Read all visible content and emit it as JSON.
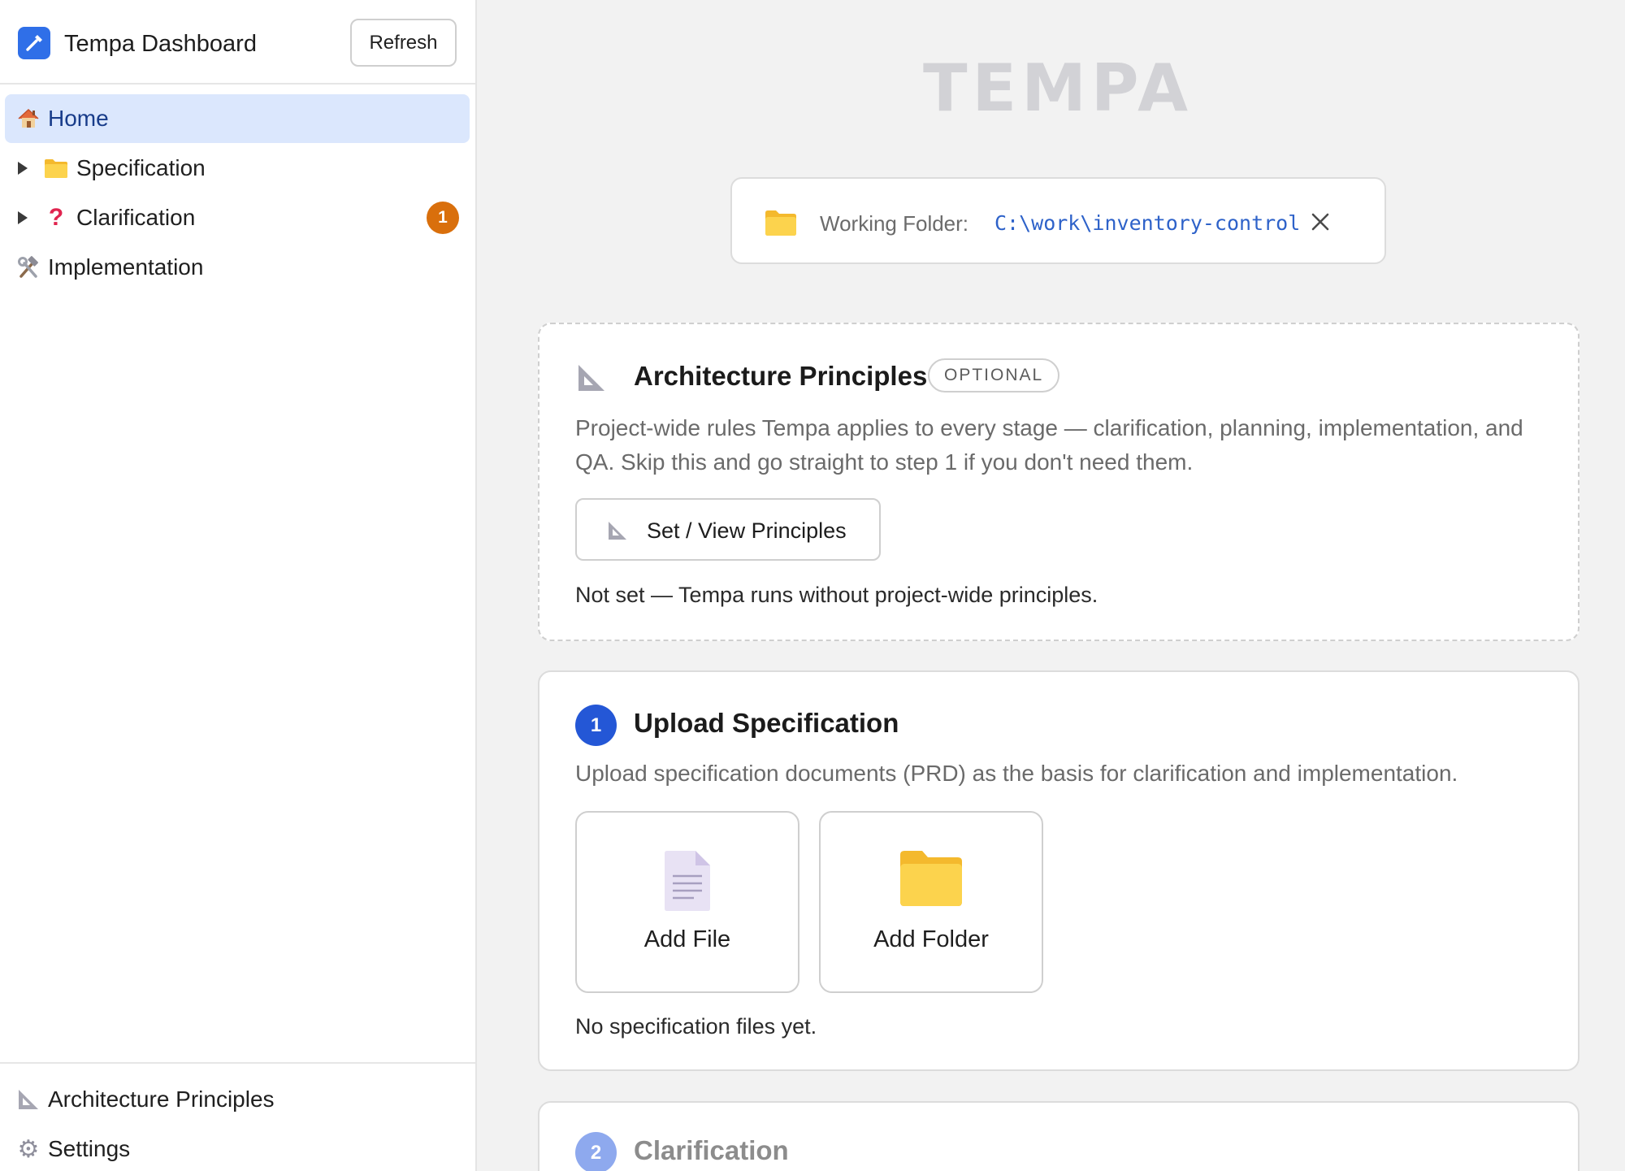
{
  "sidebar": {
    "app_title": "Tempa Dashboard",
    "refresh_label": "Refresh",
    "nav": [
      {
        "label": "Home",
        "icon": "house-icon",
        "active": true
      },
      {
        "label": "Specification",
        "icon": "folder-icon",
        "expandable": true
      },
      {
        "label": "Clarification",
        "icon": "question-mark-icon",
        "expandable": true,
        "badge": "1"
      },
      {
        "label": "Implementation",
        "icon": "hammer-wrench-icon"
      }
    ],
    "footer": [
      {
        "label": "Architecture Principles",
        "icon": "triangle-ruler-icon"
      },
      {
        "label": "Settings",
        "icon": "gear-icon"
      }
    ]
  },
  "main": {
    "brand": "TEMPA",
    "working_folder": {
      "label": "Working Folder:",
      "path": "C:\\work\\inventory-control"
    },
    "principles_card": {
      "title": "Architecture Principles",
      "tag": "OPTIONAL",
      "description": "Project-wide rules Tempa applies to every stage — clarification, planning, implementation, and QA. Skip this and go straight to step 1 if you don't need them.",
      "button_label": "Set / View Principles",
      "status": "Not set — Tempa runs without project-wide principles."
    },
    "upload_card": {
      "step": "1",
      "title": "Upload Specification",
      "description": "Upload specification documents (PRD) as the basis for clarification and implementation.",
      "add_file_label": "Add File",
      "add_folder_label": "Add Folder",
      "empty_text": "No specification files yet."
    },
    "clarification_card": {
      "step": "2",
      "title": "Clarification"
    }
  },
  "colors": {
    "accent": "#2f6fe8",
    "active_nav_bg": "#dbe7fd",
    "badge": "#d96f0c",
    "step1": "#2457d6",
    "step2_disabled": "#8ea9ee"
  }
}
